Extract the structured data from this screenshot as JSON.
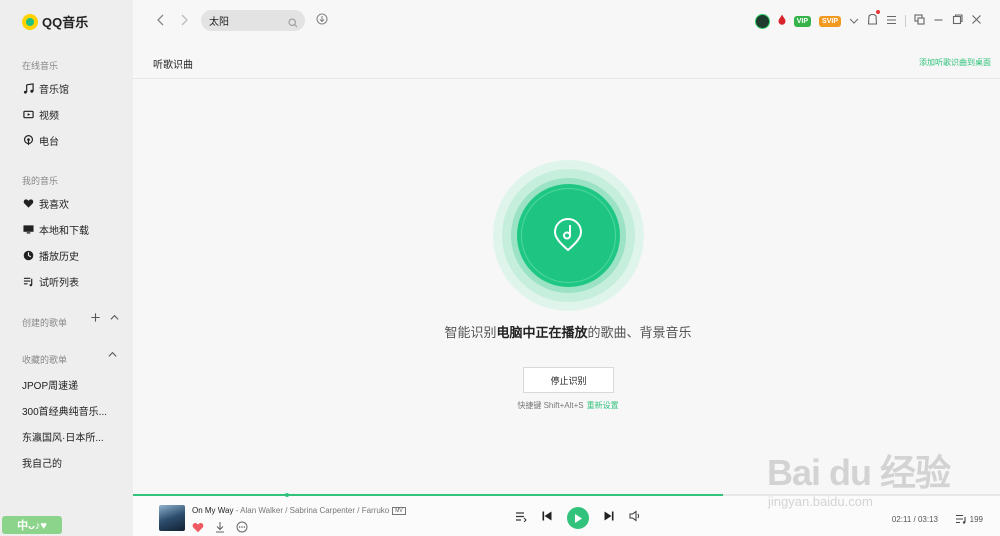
{
  "app": {
    "name": "QQ音乐"
  },
  "sidebar": {
    "online_title": "在线音乐",
    "online_items": [
      {
        "label": "音乐馆",
        "icon": "music-note-icon"
      },
      {
        "label": "视频",
        "icon": "video-icon"
      },
      {
        "label": "电台",
        "icon": "radio-icon"
      }
    ],
    "mine_title": "我的音乐",
    "mine_items": [
      {
        "label": "我喜欢",
        "icon": "heart-icon"
      },
      {
        "label": "本地和下载",
        "icon": "monitor-icon"
      },
      {
        "label": "播放历史",
        "icon": "clock-icon"
      },
      {
        "label": "试听列表",
        "icon": "playlist-icon"
      }
    ],
    "created_title": "创建的歌单",
    "collected_title": "收藏的歌单",
    "collected": [
      "JPOP周速递",
      "300首经典纯音乐...",
      "东瀛国风·日本所...",
      "我自己的"
    ],
    "mascot_text": "中ᴗ♪♥"
  },
  "topbar": {
    "search_value": "太阳",
    "badge_green": "VIP",
    "badge_orange": "SVIP"
  },
  "page": {
    "title": "听歌识曲",
    "add_desktop": "添加听歌识曲到桌面",
    "desc_prefix": "智能识别",
    "desc_bold": "电脑中正在播放",
    "desc_suffix": "的歌曲、背景音乐",
    "stop_button": "停止识别",
    "shortcut_text": "快捷键 Shift+Alt+S",
    "reset_link": "重新设置"
  },
  "player": {
    "song_title": "On My Way",
    "artists": " - Alan Walker / Sabrina Carpenter / Farruko",
    "mv_label": "MV",
    "elapsed": "02:11",
    "duration": "03:13",
    "playlist_count": "199",
    "progress": 0.68
  },
  "watermark": {
    "text": "Bai du 经验",
    "sub": "jingyan.baidu.com"
  },
  "colors": {
    "accent": "#31c27c",
    "logo_yellow": "#ffd200"
  }
}
